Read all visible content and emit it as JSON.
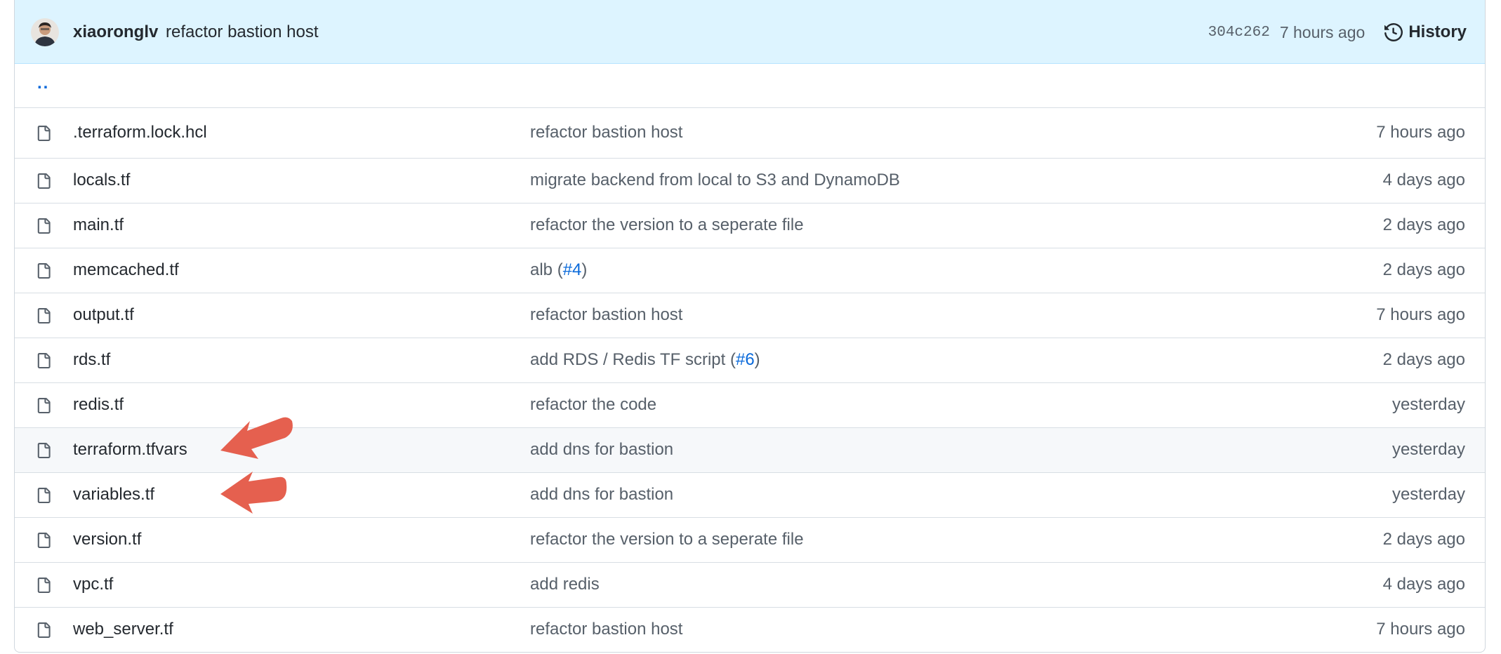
{
  "commit": {
    "author": "xiaoronglv",
    "message": "refactor bastion host",
    "sha": "304c262",
    "age": "7 hours ago",
    "history_label": "History"
  },
  "parent_link": "..",
  "files": [
    {
      "name": ".terraform.lock.hcl",
      "msg": "refactor bastion host",
      "pr": "",
      "age": "7 hours ago"
    },
    {
      "name": "locals.tf",
      "msg": "migrate backend from local to S3 and DynamoDB",
      "pr": "",
      "age": "4 days ago"
    },
    {
      "name": "main.tf",
      "msg": "refactor the version to a seperate file",
      "pr": "",
      "age": "2 days ago"
    },
    {
      "name": "memcached.tf",
      "msg": "alb (",
      "pr": "#4",
      "age": "2 days ago"
    },
    {
      "name": "output.tf",
      "msg": "refactor bastion host",
      "pr": "",
      "age": "7 hours ago"
    },
    {
      "name": "rds.tf",
      "msg": "add RDS / Redis TF script (",
      "pr": "#6",
      "age": "2 days ago"
    },
    {
      "name": "redis.tf",
      "msg": "refactor the code",
      "pr": "",
      "age": "yesterday"
    },
    {
      "name": "terraform.tfvars",
      "msg": "add dns for bastion",
      "pr": "",
      "age": "yesterday"
    },
    {
      "name": "variables.tf",
      "msg": "add dns for bastion",
      "pr": "",
      "age": "yesterday"
    },
    {
      "name": "version.tf",
      "msg": "refactor the version to a seperate file",
      "pr": "",
      "age": "2 days ago"
    },
    {
      "name": "vpc.tf",
      "msg": "add redis",
      "pr": "",
      "age": "4 days ago"
    },
    {
      "name": "web_server.tf",
      "msg": "refactor bastion host",
      "pr": "",
      "age": "7 hours ago"
    }
  ],
  "colors": {
    "commit_bar_bg": "#ddf4ff",
    "link": "#0969da",
    "muted": "#57606a",
    "annotation_arrow": "#e5604f"
  },
  "icons": {
    "history": "history-clock-icon",
    "file": "file-icon",
    "annotation": "red-arrow-annotation"
  }
}
